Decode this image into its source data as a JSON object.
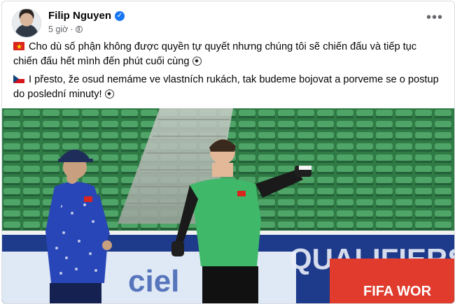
{
  "post": {
    "author": "Filip Nguyen",
    "time": "5 giờ",
    "dot": "·",
    "more": "•••",
    "verified_icon": "verified-badge-icon",
    "privacy_icon": "globe-icon",
    "text_vi": "Cho dù số phận không được quyền tự quyết nhưng chúng tôi sẽ chiến đấu và tiếp tục chiến đấu hết mình đến phút cuối cùng",
    "text_cs": "I přesto, že osud nemáme ve vlastních rukách, tak budeme bojovat a porveme se o postup do poslední minuty!",
    "flag_vi": "vietnam-flag-icon",
    "flag_cs": "czech-flag-icon",
    "emoji": "soccer-ball-icon"
  },
  "photo": {
    "banner_text": "QUALIFIERS",
    "banner_text_2": "FIFA WOR",
    "banner_text_3": "ciel"
  },
  "colors": {
    "link_blue": "#1877f2",
    "secondary_text": "#65676b",
    "stadium_green": "#3c8a4f",
    "kit_green": "#3fb86a",
    "kit_blue": "#1e3a8a"
  }
}
